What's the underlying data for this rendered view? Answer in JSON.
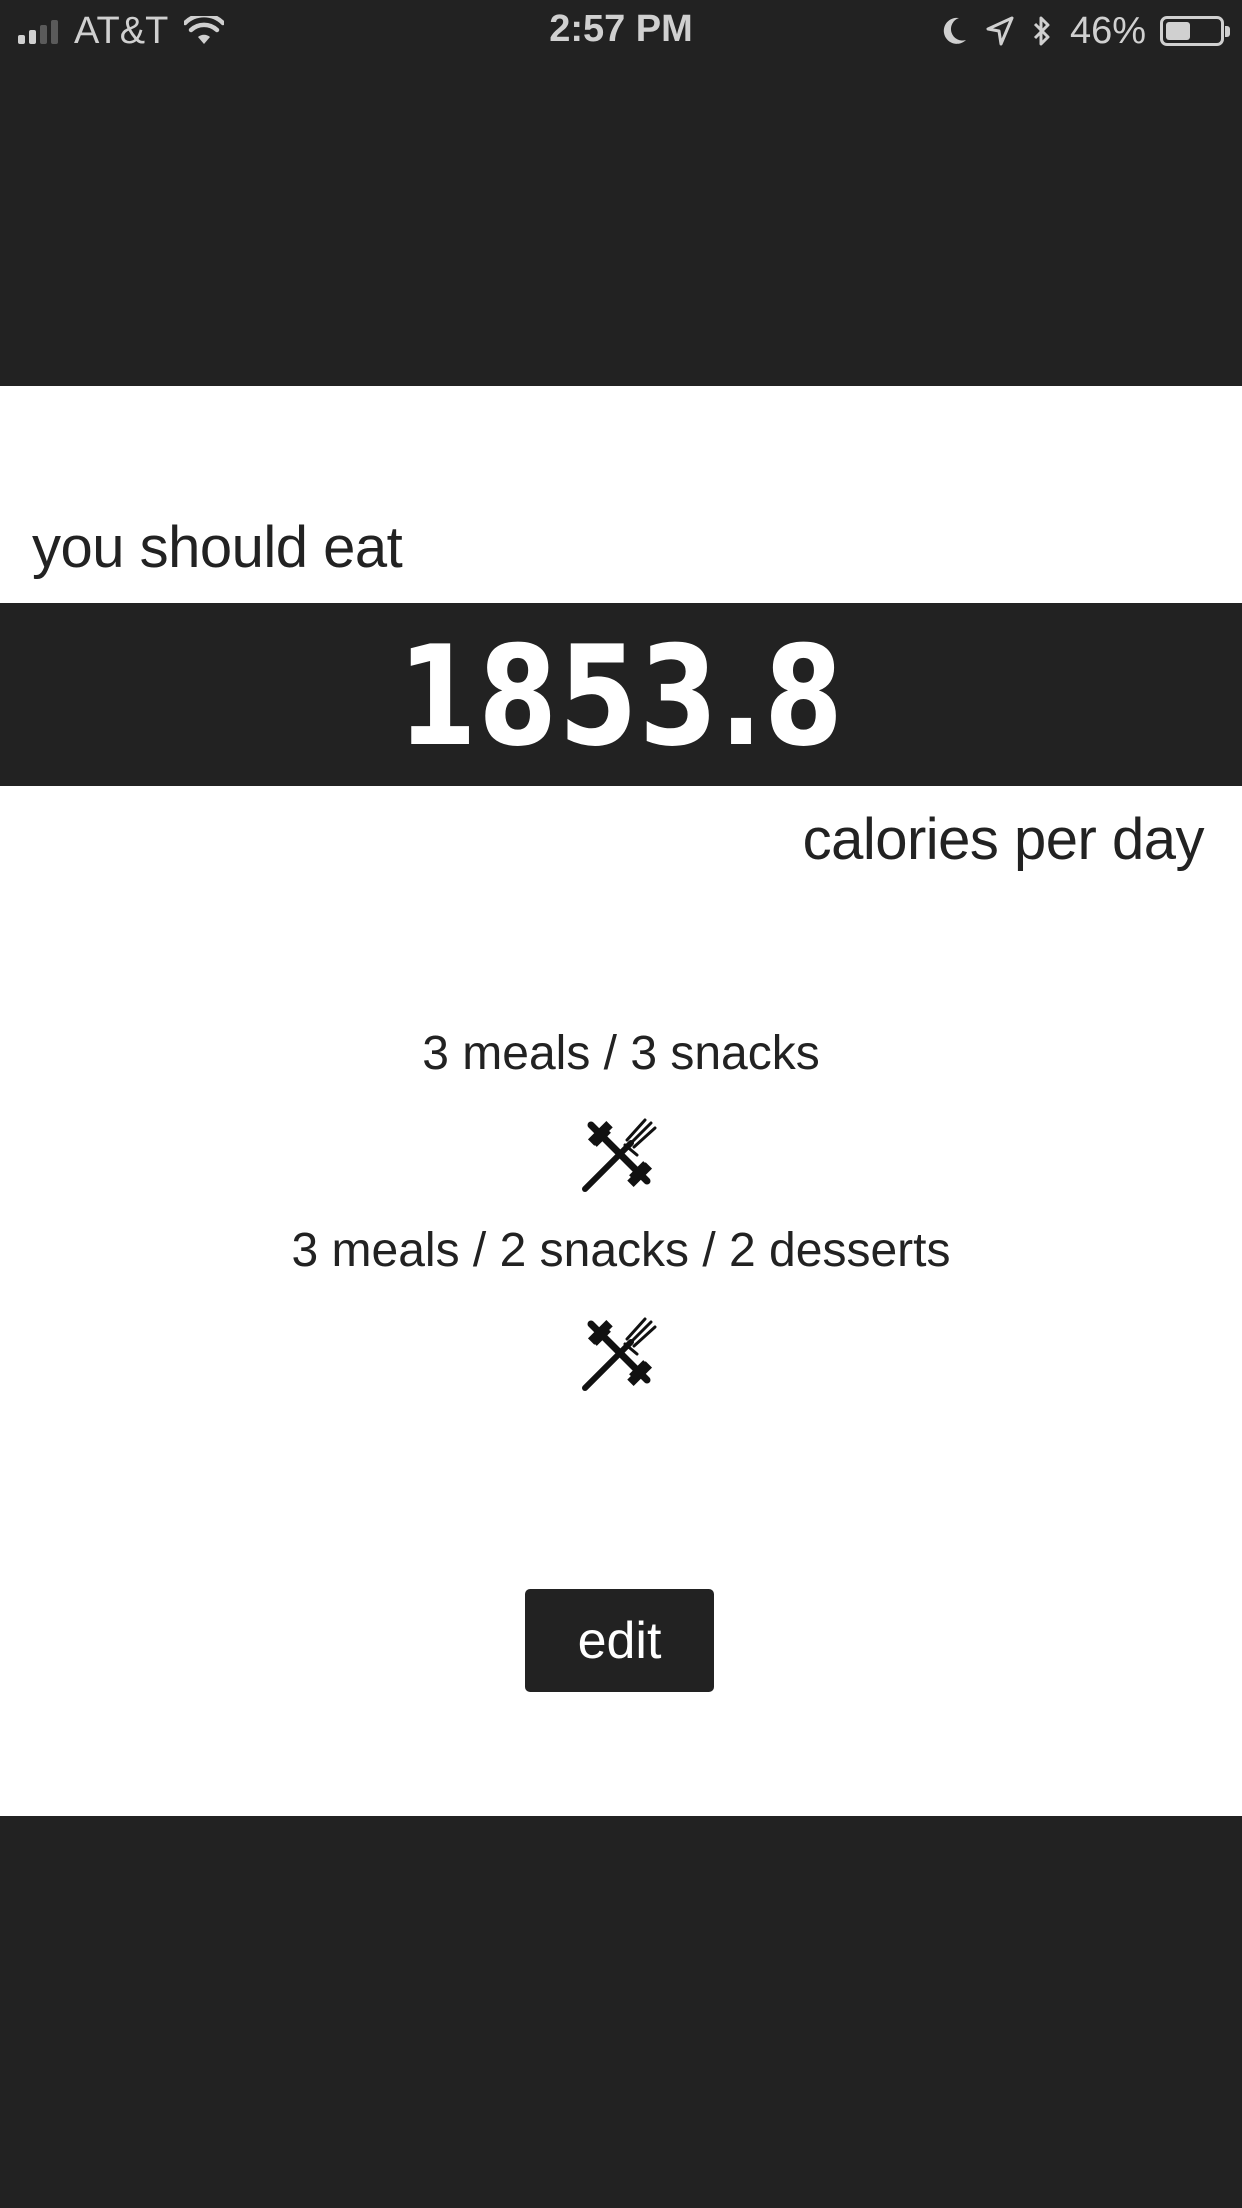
{
  "status_bar": {
    "carrier": "AT&T",
    "time": "2:57 PM",
    "battery_percent": "46%",
    "battery_level": 0.46,
    "signal_bars": 2,
    "icons": [
      "signal-icon",
      "wifi-icon",
      "moon-icon",
      "location-arrow-icon",
      "bluetooth-icon",
      "battery-icon"
    ]
  },
  "result": {
    "intro": "you should eat",
    "calories": "1853.8",
    "unit": "calories per day"
  },
  "plans": [
    {
      "label": "3 meals / 3 snacks",
      "icon": "dumbbell-fork-icon"
    },
    {
      "label": "3 meals / 2 snacks / 2 desserts",
      "icon": "dumbbell-fork-icon"
    }
  ],
  "actions": {
    "edit_label": "edit"
  },
  "colors": {
    "background": "#222222",
    "card": "#ffffff",
    "text": "#222222",
    "accent_text": "#ffffff"
  }
}
